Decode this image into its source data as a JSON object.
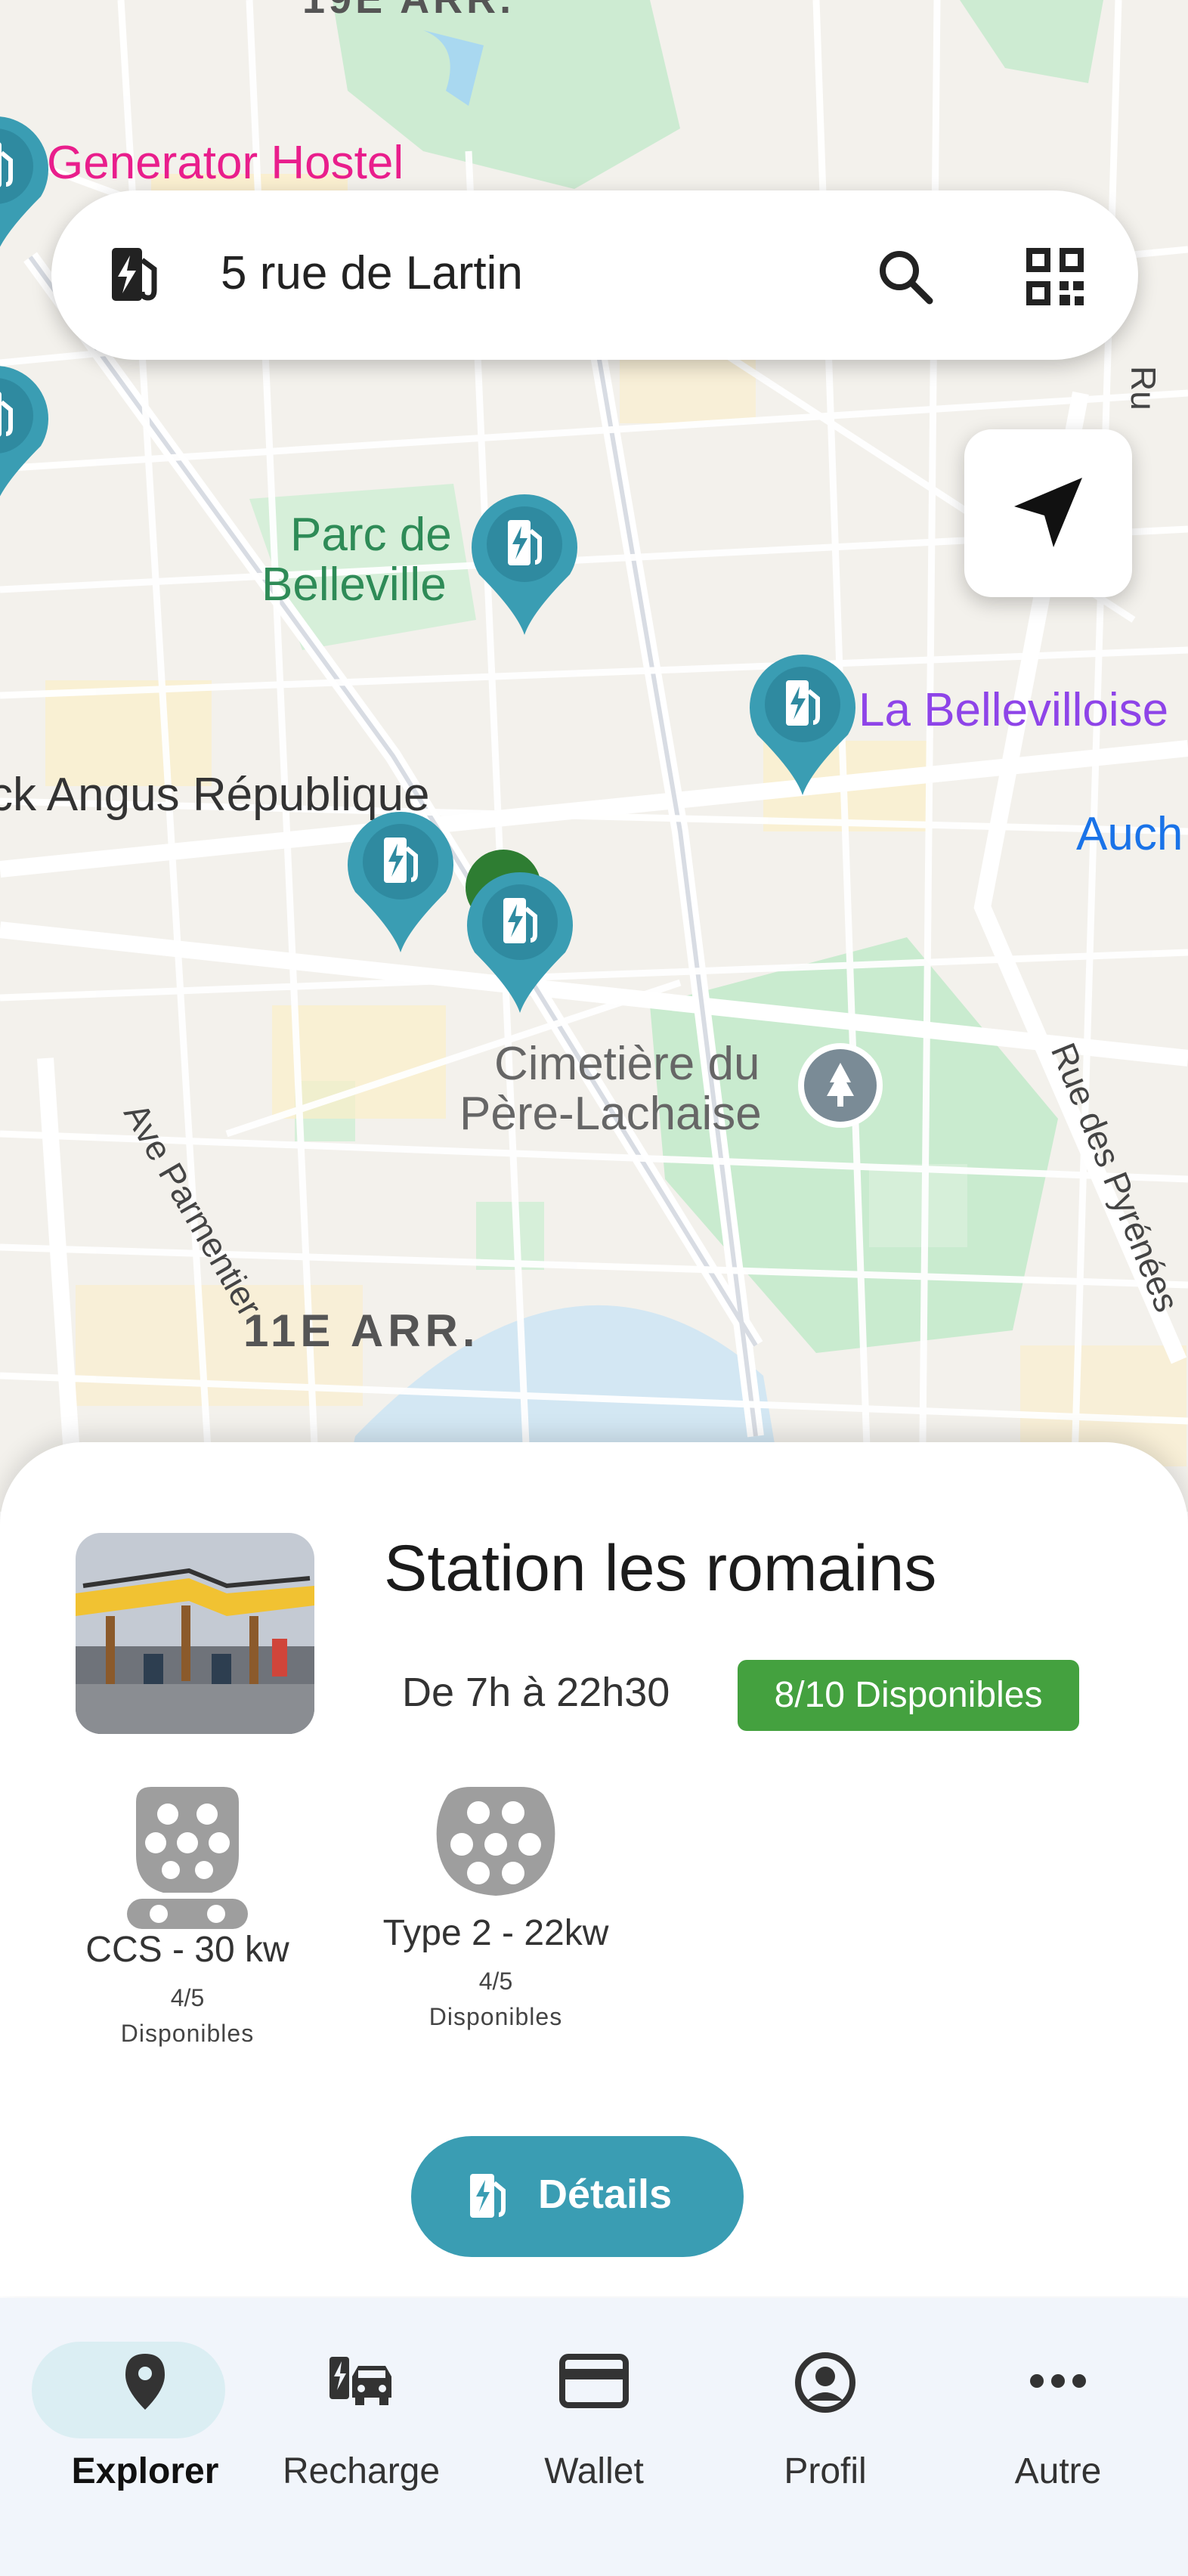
{
  "map": {
    "labels": {
      "arrondissement_top": "19E ARR.",
      "generator_hostel": "Generator Hostel",
      "parc_line1": "Parc de",
      "parc_line2": "Belleville",
      "la_bellevilloise": "La Bellevilloise",
      "angus": "ck Angus République",
      "auchan": "Auch",
      "cimetiere_line1": "Cimetière du",
      "cimetiere_line2": "Père-Lachaise",
      "ave_parmentier": "Ave Parmentier",
      "rue_pyrenees": "Rue des Pyrénées",
      "arrondissement_11": "11E ARR.",
      "rue_edge": "Ru"
    },
    "colors": {
      "pin": "#3a9db3",
      "pin_green": "#2e7d32",
      "poi_pink": "#e91e8c",
      "poi_purple": "#8e44e8",
      "auchan_blue": "#1a73e8",
      "park": "#c9ebcf"
    }
  },
  "search": {
    "value": "5 rue de Lartin",
    "station_icon": "ev-station-icon",
    "search_icon": "search-icon",
    "qr_icon": "qr-code-icon"
  },
  "locate": {
    "icon": "navigation-arrow-icon"
  },
  "station": {
    "name": "Station les romains",
    "hours": "De 7h à 22h30",
    "availability": "8/10 Disponibles",
    "availability_color": "#44a13f",
    "connectors": [
      {
        "name": "CCS - 30 kw",
        "count": "4/5",
        "status": "Disponibles",
        "icon": "ccs-connector-icon"
      },
      {
        "name": "Type 2 - 22kw",
        "count": "4/5",
        "status": "Disponibles",
        "icon": "type2-connector-icon"
      }
    ],
    "details_label": "Détails",
    "details_color": "#3a9db3"
  },
  "nav": {
    "items": [
      {
        "label": "Explorer",
        "icon": "location-pin-icon",
        "active": true
      },
      {
        "label": "Recharge",
        "icon": "car-charging-icon",
        "active": false
      },
      {
        "label": "Wallet",
        "icon": "card-icon",
        "active": false
      },
      {
        "label": "Profil",
        "icon": "account-icon",
        "active": false
      },
      {
        "label": "Autre",
        "icon": "more-icon",
        "active": false
      }
    ]
  }
}
